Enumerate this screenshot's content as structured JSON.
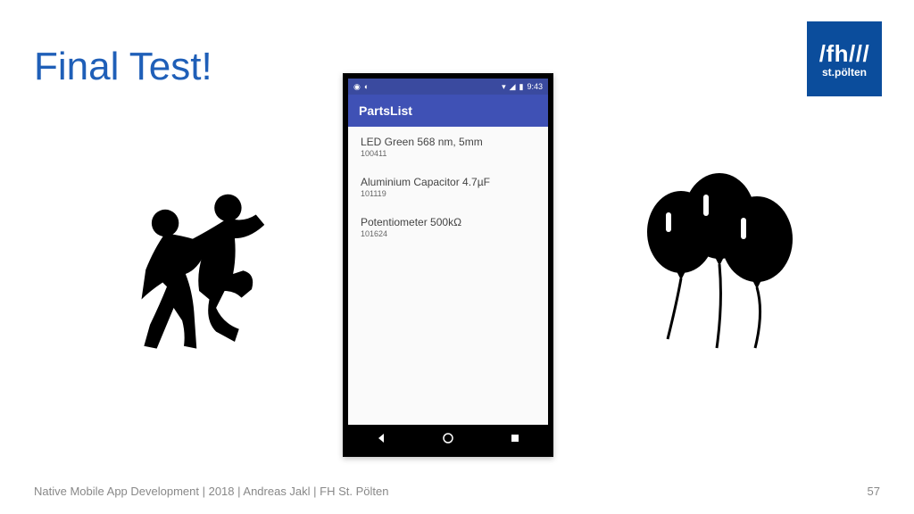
{
  "slide": {
    "title": "Final Test!",
    "footer": "Native Mobile App Development | 2018 | Andreas Jakl | FH St. Pölten",
    "number": "57"
  },
  "logo": {
    "top": "/fh///",
    "bottom": "st.pölten"
  },
  "phone": {
    "status": {
      "time": "9:43"
    },
    "app_title": "PartsList",
    "items": [
      {
        "title": "LED Green 568 nm, 5mm",
        "id": "100411"
      },
      {
        "title": "Aluminium Capacitor 4.7µF",
        "id": "101119"
      },
      {
        "title": "Potentiometer 500kΩ",
        "id": "101624"
      }
    ]
  }
}
